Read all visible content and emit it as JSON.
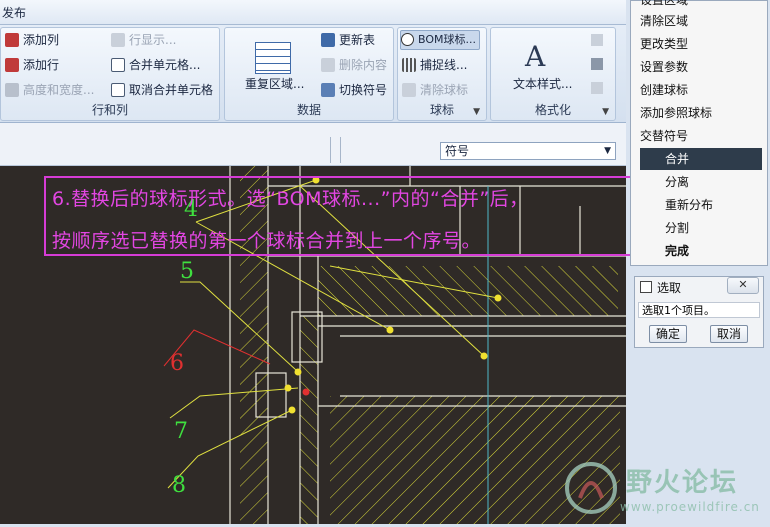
{
  "tabs": {
    "publish": "发布"
  },
  "ribbon": {
    "rows_cols": {
      "label": "行和列",
      "add_column": "添加列",
      "add_row": "添加行",
      "height_width": "高度和宽度...",
      "row_display": "行显示...",
      "merge_cells": "合并单元格...",
      "unmerge_cells": "取消合并单元格"
    },
    "data": {
      "label": "数据",
      "repeat_region": "重复区域...",
      "update_table": "更新表",
      "delete_content": "删除内容",
      "switch_symbol": "切换符号"
    },
    "balloon": {
      "label": "球标",
      "bom_balloon": "BOM球标...",
      "capture_line": "捕捉线...",
      "clear_balloon": "清除球标"
    },
    "format": {
      "label": "格式化",
      "text_style": "文本样式..."
    }
  },
  "subbar": {
    "symbol_value": "符号"
  },
  "menu": {
    "items": [
      "设置区域",
      "清除区域",
      "更改类型",
      "设置参数",
      "创建球标",
      "添加参照球标",
      "交替符号",
      "合并",
      "分离",
      "重新分布",
      "分割",
      "完成"
    ],
    "selected": "合并"
  },
  "pick_dialog": {
    "title": "选取",
    "close": "✕",
    "message": "选取1个项目。",
    "ok": "确定",
    "cancel": "取消"
  },
  "annotation": {
    "line1": "6.替换后的球标形式。选“BOM球标...”内的“合并”后，",
    "line2": "按顺序选已替换的第一个球标合并到上一个序号。"
  },
  "drawing": {
    "balloons": [
      "4",
      "5",
      "6",
      "7",
      "8"
    ]
  },
  "watermark": {
    "title": "野火论坛",
    "url": "www.proewildfire.cn"
  },
  "colors": {
    "canvas": "#2f2a27",
    "drawing_lines": "#e8e6d8",
    "hatch": "#e0e040",
    "annotation": "#e246e2",
    "balloon_green": "#3fe03f",
    "balloon_red": "#e03030"
  }
}
